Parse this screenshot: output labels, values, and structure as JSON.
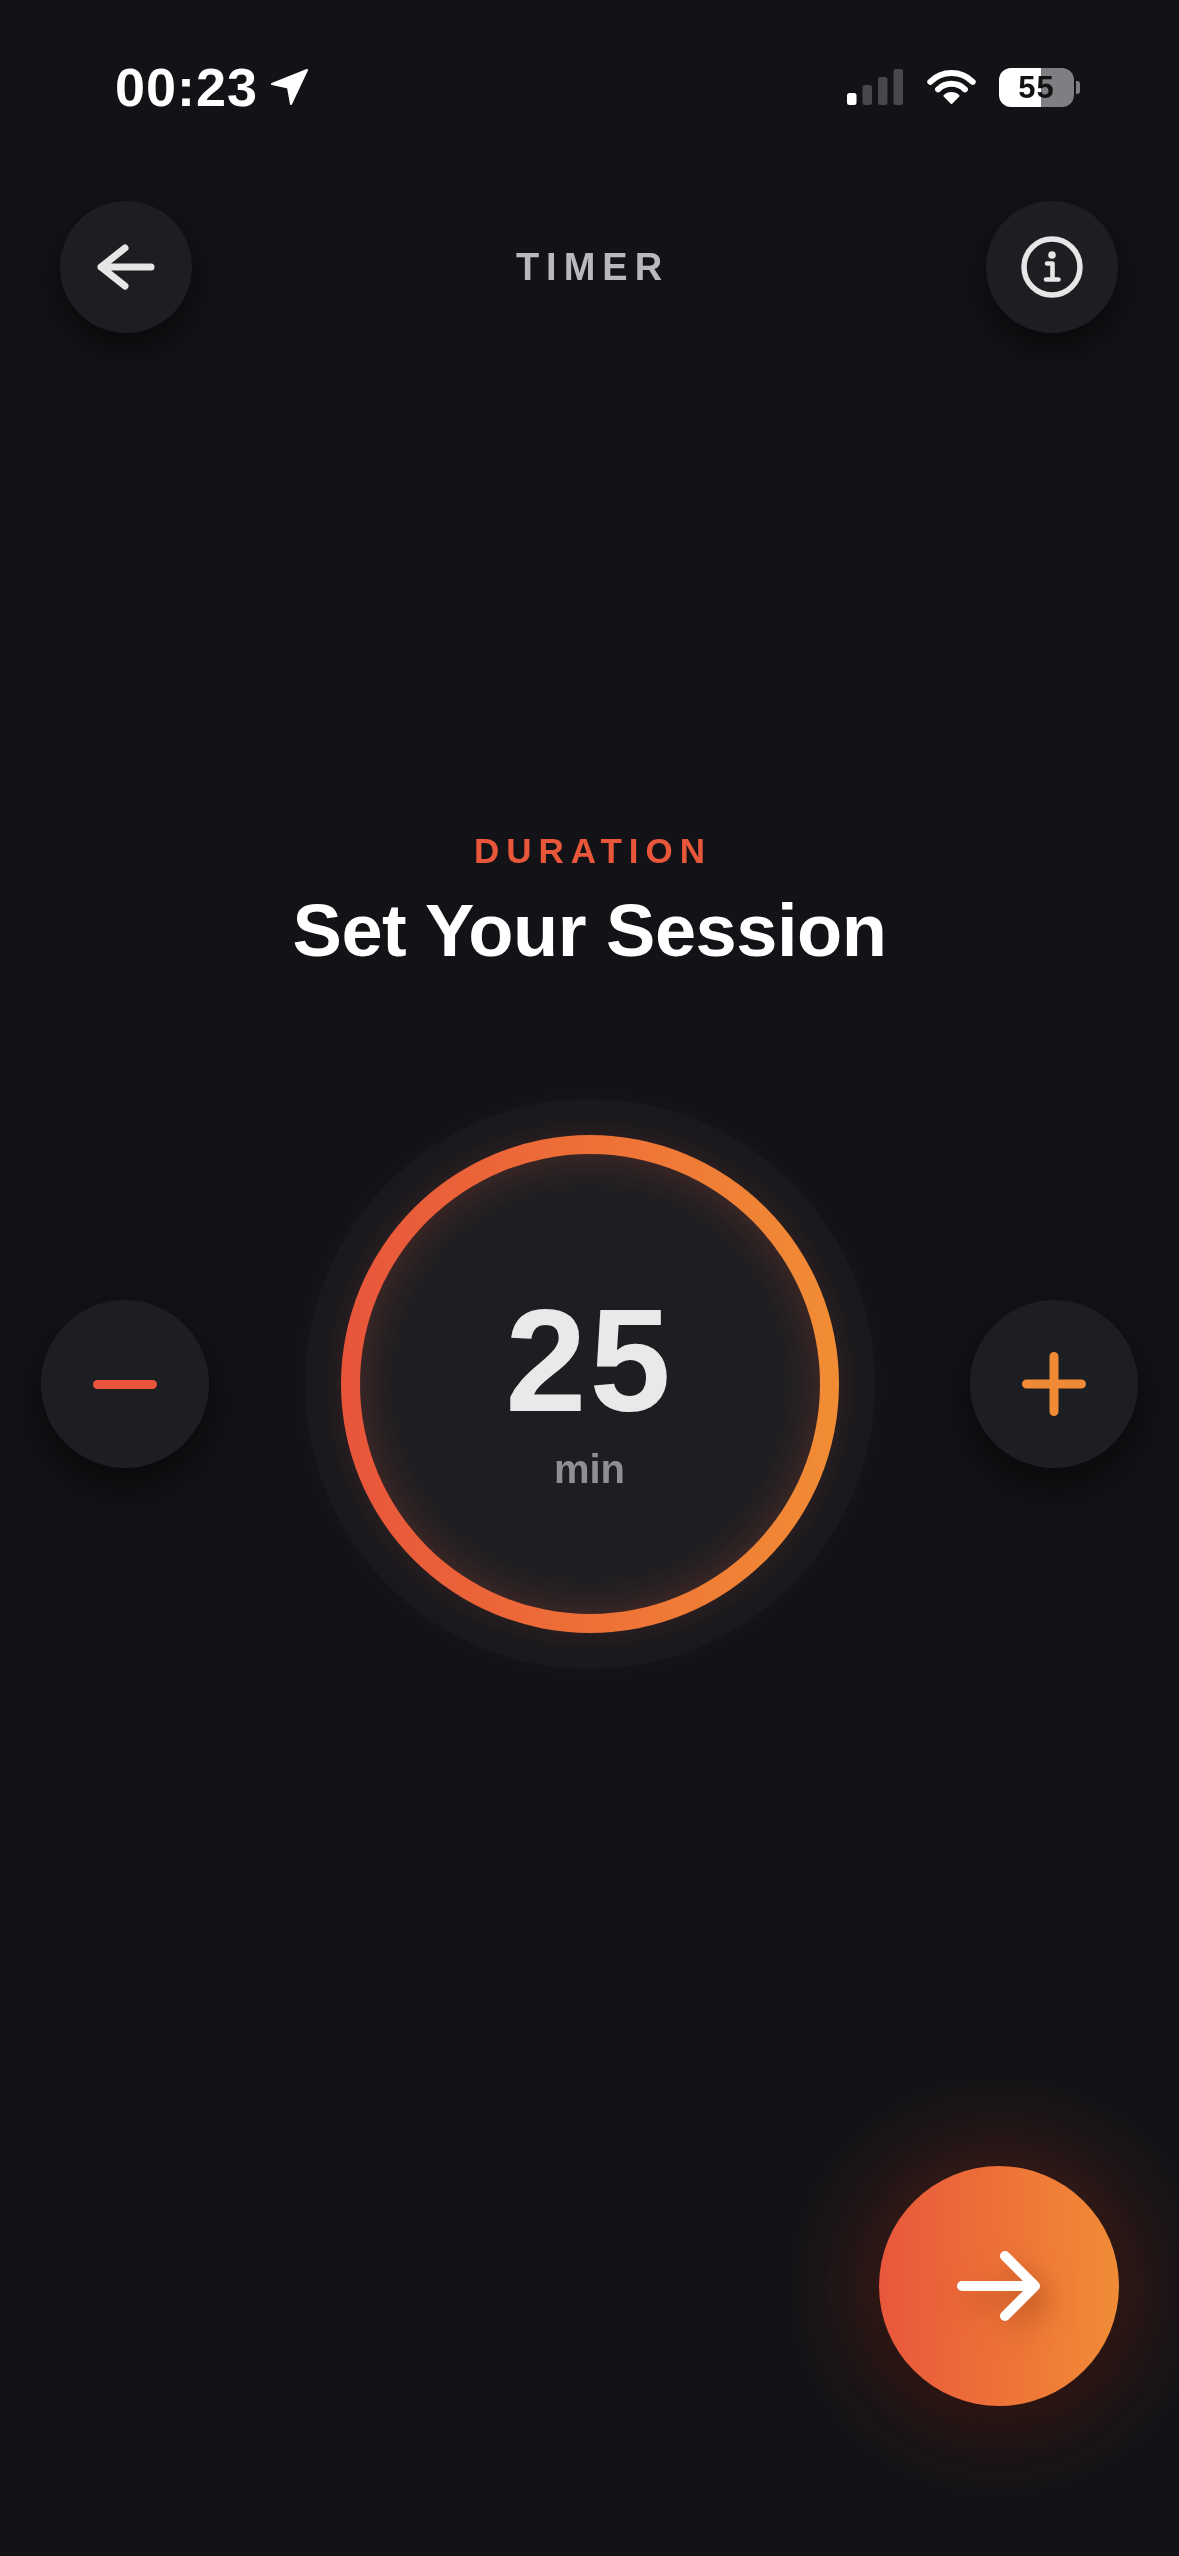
{
  "status_bar": {
    "time": "00:23",
    "battery": "55"
  },
  "header": {
    "title": "TIMER"
  },
  "heading": {
    "eyebrow": "DURATION",
    "title": "Set Your Session"
  },
  "dial": {
    "value": "25",
    "unit": "min"
  }
}
